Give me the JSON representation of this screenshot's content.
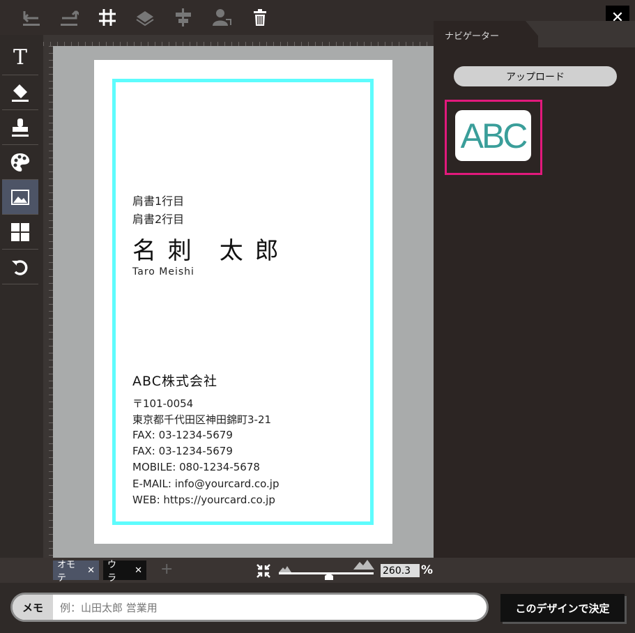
{
  "toolbar": {
    "icons": [
      "undo-icon",
      "redo-icon",
      "grid-icon",
      "layer-icon",
      "align-icon",
      "person-icon",
      "trash-icon"
    ],
    "close_symbol": "✕"
  },
  "left_tools": {
    "text_symbol": "T",
    "items": [
      "text-tool",
      "eraser-tool",
      "stamp-tool",
      "palette-tool",
      "image-tool",
      "layout-tool",
      "reset-tool"
    ],
    "active": "image-tool"
  },
  "card": {
    "title_line1": "肩書1行目",
    "title_line2": "肩書2行目",
    "name": "名 刺　太 郎",
    "name_roman": "Taro Meishi",
    "company": "ABC株式会社",
    "postal": "〒101-0054",
    "address": "東京都千代田区神田錦町3-21",
    "fax1": "FAX: 03-1234-5679",
    "fax2": "FAX: 03-1234-5679",
    "mobile": "MOBILE: 080-1234-5678",
    "email": "E-MAIL: info@yourcard.co.jp",
    "web": "WEB: https://yourcard.co.jp",
    "border_color": "#5efcfd"
  },
  "navigator": {
    "tab_label": "ナビゲーター",
    "upload_label": "アップロード",
    "logo_text": "ABC",
    "logo_color": "#3a9e9a",
    "highlight_color": "#e2197c"
  },
  "bottom": {
    "tab_front": "オモテ",
    "tab_back": "ウラ",
    "close_symbol": "✕",
    "add_symbol": "+",
    "zoom_value": "260.3",
    "zoom_unit": "%",
    "zoom_level": 0.37
  },
  "memo": {
    "label": "メモ",
    "placeholder": "例：山田太郎 営業用",
    "value": ""
  },
  "decide_label": "このデザインで決定"
}
